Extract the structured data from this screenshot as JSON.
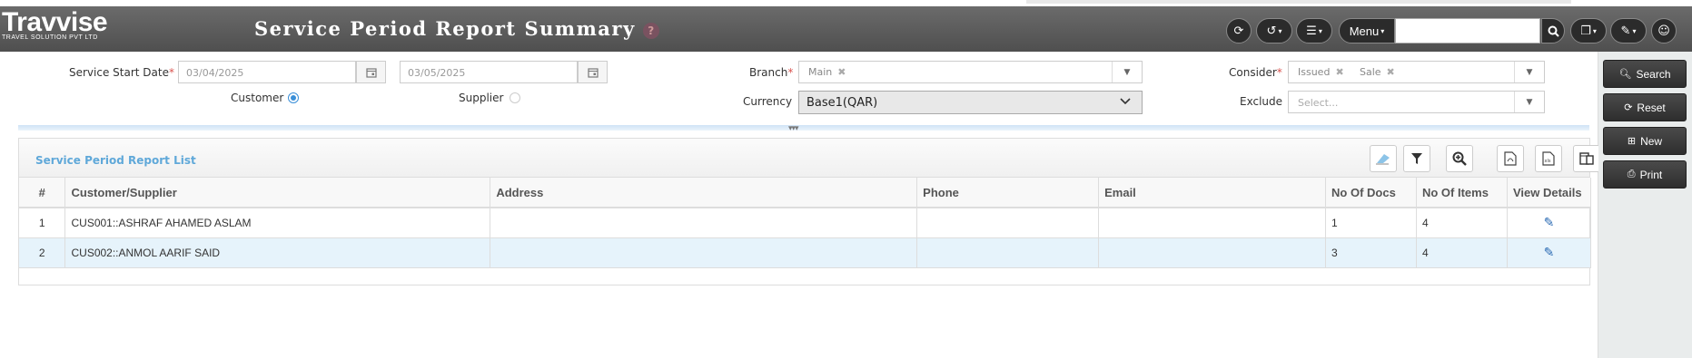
{
  "header": {
    "logo_name": "Travvise",
    "logo_tagline": "TRAVEL SOLUTION PVT LTD",
    "title": "Service Period Report Summary",
    "help_icon": "?",
    "menu_label": "Menu",
    "search_placeholder": ""
  },
  "filters": {
    "service_start_date_label": "Service Start Date",
    "date_from": "03/04/2025",
    "date_to": "03/05/2025",
    "customer_label": "Customer",
    "supplier_label": "Supplier",
    "selected_party": "Customer",
    "branch_label": "Branch",
    "branch_values": [
      "Main"
    ],
    "currency_label": "Currency",
    "currency_value": "Base1(QAR)",
    "consider_label": "Consider",
    "consider_values": [
      "Issued",
      "Sale"
    ],
    "exclude_label": "Exclude",
    "exclude_placeholder": "Select..."
  },
  "list": {
    "title": "Service Period Report List",
    "columns": [
      "#",
      "Customer/Supplier",
      "Address",
      "Phone",
      "Email",
      "No Of Docs",
      "No Of Items",
      "View Details"
    ],
    "rows": [
      {
        "num": "1",
        "party": "CUS001::ASHRAF AHAMED ASLAM",
        "address": "",
        "phone": "",
        "email": "",
        "docs": "1",
        "items": "4"
      },
      {
        "num": "2",
        "party": "CUS002::ANMOL AARIF SAID",
        "address": "",
        "phone": "",
        "email": "",
        "docs": "3",
        "items": "4"
      }
    ]
  },
  "sidebar": {
    "search_label": "Search",
    "reset_label": "Reset",
    "new_label": "New",
    "print_label": "Print"
  },
  "colors": {
    "header_bg": "#5a5a5a",
    "accent_blue": "#5fa8d9",
    "row_highlight": "#e6f3fb",
    "required": "#d9534f"
  }
}
